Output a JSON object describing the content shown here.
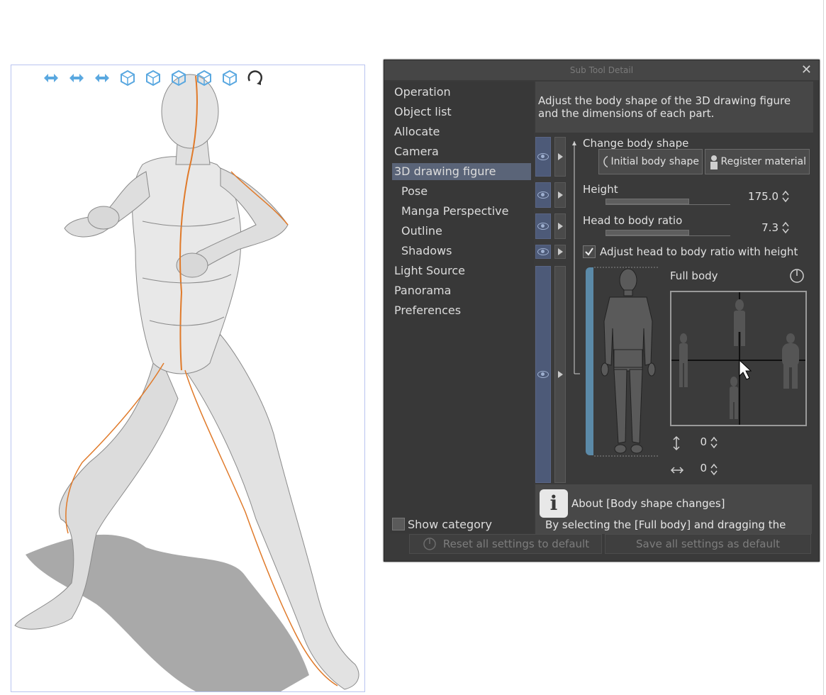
{
  "toolbar3d": {
    "icons": [
      "rotate-camera-icon",
      "pan-camera-icon",
      "dolly-camera-icon",
      "move-object-icon",
      "rotate-object-xz-icon",
      "rotate-object-xy-icon",
      "rotate-object-y-icon",
      "snap-to-floor-icon",
      "rotate-object-reset-icon"
    ],
    "color": "#5aa8e0"
  },
  "panel": {
    "title": "Sub Tool Detail",
    "close": "✕",
    "categories": [
      {
        "label": "Operation",
        "sub": false
      },
      {
        "label": "Object list",
        "sub": false
      },
      {
        "label": "Allocate",
        "sub": false
      },
      {
        "label": "Camera",
        "sub": false
      },
      {
        "label": "3D drawing figure",
        "sub": false,
        "selected": true
      },
      {
        "label": "Pose",
        "sub": true
      },
      {
        "label": "Manga Perspective",
        "sub": true
      },
      {
        "label": "Outline",
        "sub": true
      },
      {
        "label": "Shadows",
        "sub": true
      },
      {
        "label": "Light Source",
        "sub": false
      },
      {
        "label": "Panorama",
        "sub": false
      },
      {
        "label": "Preferences",
        "sub": false
      }
    ],
    "show_category": "Show category",
    "description": "Adjust the body shape of the 3D drawing figure and the dimensions of each part.",
    "change_body_shape": "Change body shape",
    "initial_body_shape": "Initial body shape",
    "register_material": "Register material",
    "height_label": "Height",
    "height_value": "175.0",
    "height_fraction": 0.67,
    "head_ratio_label": "Head to body ratio",
    "head_ratio_value": "7.3",
    "head_ratio_fraction": 0.67,
    "adjust_with_height": "Adjust head to body ratio with height",
    "adjust_checked": true,
    "full_body": "Full body",
    "vertical_value": "0",
    "horizontal_value": "0",
    "info_icon": "i",
    "info_title": "About [Body shape changes]",
    "info_body": "By selecting the [Full body] and dragging the",
    "reset_label": "Reset all settings to default",
    "save_label": "Save all settings as default"
  },
  "colors": {
    "panel_bg": "#3a3a3a",
    "selected": "#5a6478",
    "accent_bar": "#5b8aa8",
    "figure_line": "#e07a2a"
  }
}
